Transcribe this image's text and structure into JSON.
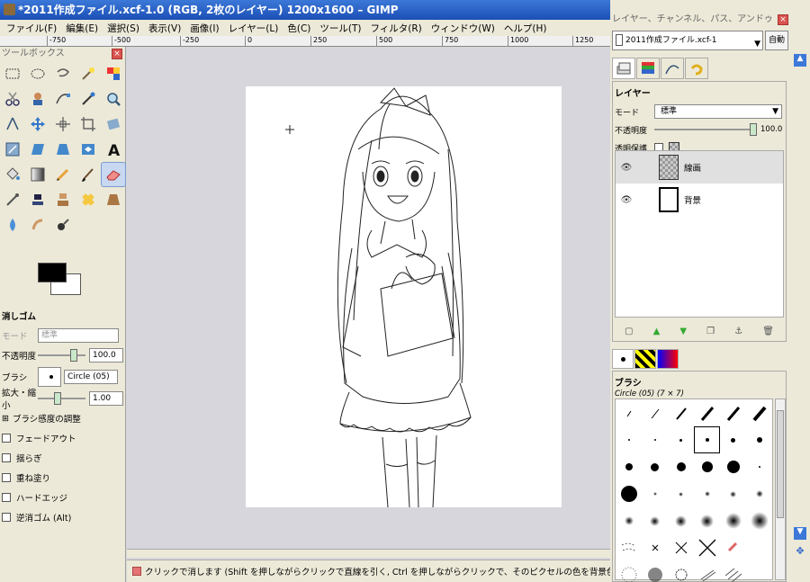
{
  "window": {
    "title": "*2011作成ファイル.xcf-1.0 (RGB, 2枚のレイヤー) 1200x1600 – GIMP"
  },
  "menu": [
    "ファイル(F)",
    "編集(E)",
    "選択(S)",
    "表示(V)",
    "画像(I)",
    "レイヤー(L)",
    "色(C)",
    "ツール(T)",
    "フィルタ(R)",
    "ウィンドウ(W)",
    "ヘルプ(H)"
  ],
  "ruler": [
    "-750",
    "-500",
    "-250",
    "0",
    "250",
    "500",
    "750",
    "1000",
    "1250"
  ],
  "toolbox": {
    "title": "ツールボックス",
    "close": "×",
    "tool_options": {
      "title": "消しゴム",
      "mode_label": "モード",
      "mode_value": "標準",
      "opacity_label": "不透明度",
      "opacity_value": "100.0",
      "brush_label": "ブラシ",
      "brush_value": "Circle (05)",
      "scale_label": "拡大・縮小",
      "scale_value": "1.00",
      "pressure_label": "ブラシ感度の調整",
      "checkboxes": [
        "フェードアウト",
        "揺らぎ",
        "重ね塗り",
        "ハードエッジ",
        "逆消ゴム (Alt)"
      ]
    }
  },
  "status": {
    "message": "クリックで消します (Shift を押しながらクリックで直線を引く, Ctrl を押しながらクリックで、そのピクセルの色を背景色に設定 もでき"
  },
  "dock": {
    "title": "レイヤー、チャンネル、パス、アンドゥ",
    "close": "×",
    "image_selector": "2011作成ファイル.xcf-1",
    "auto_button": "自動",
    "layers": {
      "title": "レイヤー",
      "mode_label": "モード",
      "mode_value": "標準",
      "opacity_label": "不透明度",
      "opacity_value": "100.0",
      "lock_label": "透明保護",
      "items": [
        {
          "name": "線画",
          "active": true
        },
        {
          "name": "背景",
          "active": false
        }
      ]
    },
    "brushes": {
      "title": "ブラシ",
      "selected": "Circle (05) (7 × 7)"
    }
  }
}
